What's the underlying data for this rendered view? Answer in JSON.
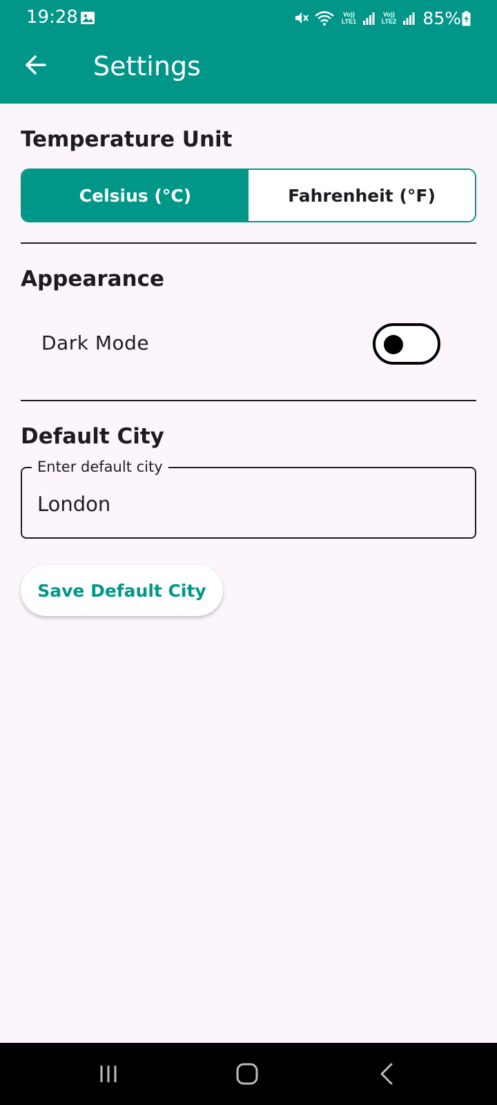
{
  "status_bar": {
    "time": "19:28",
    "sim1_label": "Vo)) LTE1",
    "sim2_label": "Vo)) LTE2",
    "battery": "85%"
  },
  "app_bar": {
    "title": "Settings"
  },
  "temperature": {
    "section_title": "Temperature Unit",
    "options": [
      "Celsius (°C)",
      "Fahrenheit (°F)"
    ],
    "selected": "Celsius (°C)"
  },
  "appearance": {
    "section_title": "Appearance",
    "dark_mode_label": "Dark Mode",
    "dark_mode_on": false
  },
  "default_city": {
    "section_title": "Default City",
    "field_label": "Enter default city",
    "value": "London",
    "save_label": "Save Default City"
  },
  "colors": {
    "primary": "#009688",
    "background": "#fcf5fc",
    "text": "#1d1b20"
  },
  "icons": {
    "back": "arrow-left-icon",
    "recents": "recents-icon",
    "home": "home-icon",
    "nav_back": "chevron-left-icon"
  }
}
